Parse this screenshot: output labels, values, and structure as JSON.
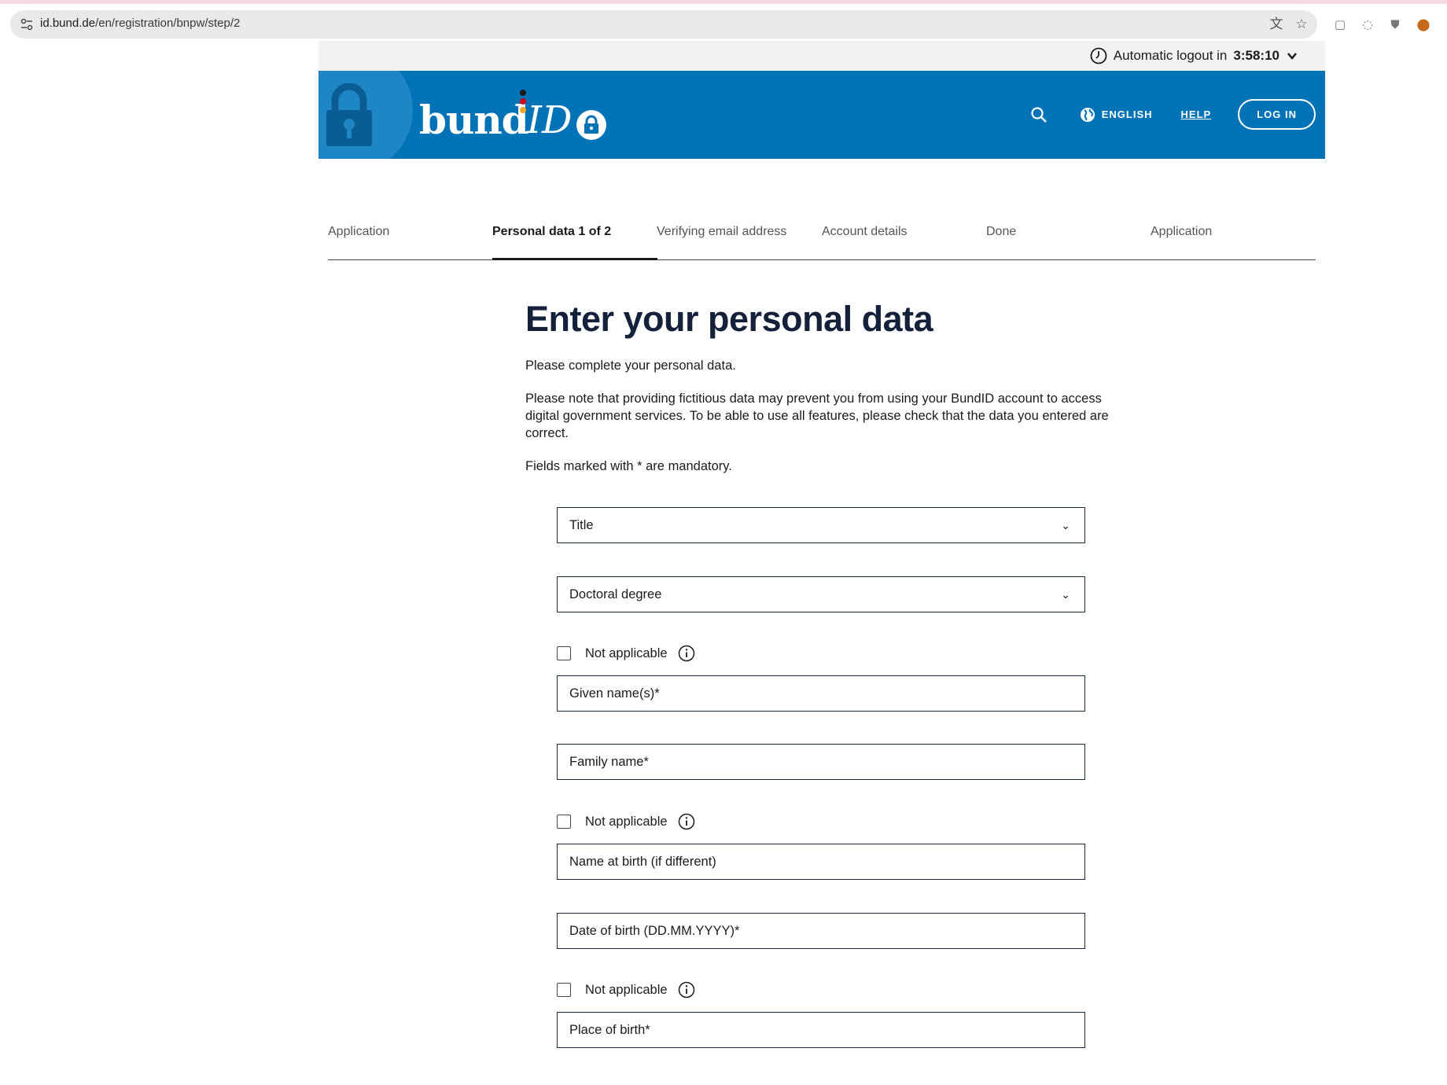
{
  "browser": {
    "url_host": "id.bund.de",
    "url_path": "/en/registration/bnpw/step/2"
  },
  "logout": {
    "label": "Automatic logout in",
    "timer": "3:58:10"
  },
  "header": {
    "logo_word": "bund",
    "logo_id": "ID",
    "language": "ENGLISH",
    "help": "HELP",
    "login": "LOG IN",
    "colors": {
      "brand_blue": "#0073b7",
      "dot_black": "#1b1b1b",
      "dot_red": "#d0021b",
      "dot_gold": "#f5a623"
    }
  },
  "stepper": {
    "steps": [
      {
        "label": "Application"
      },
      {
        "label": "Personal data 1 of 2"
      },
      {
        "label": "Verifying email address"
      },
      {
        "label": "Account details"
      },
      {
        "label": "Done"
      },
      {
        "label": "Application"
      }
    ]
  },
  "page": {
    "title": "Enter your personal data",
    "intro": "Please complete your personal data.",
    "note": "Please note that providing fictitious data may prevent you from using your BundID account to access digital government services. To be able to use all features, please check that the data you entered are correct.",
    "mandatory": "Fields marked with * are mandatory."
  },
  "form": {
    "title_select": "Title",
    "degree_select": "Doctoral degree",
    "not_applicable": "Not applicable",
    "given_name": "Given name(s)*",
    "family_name": "Family name*",
    "birth_name": "Name at birth (if different)",
    "date_of_birth": "Date of birth (DD.MM.YYYY)*",
    "place_of_birth": "Place of birth*"
  }
}
